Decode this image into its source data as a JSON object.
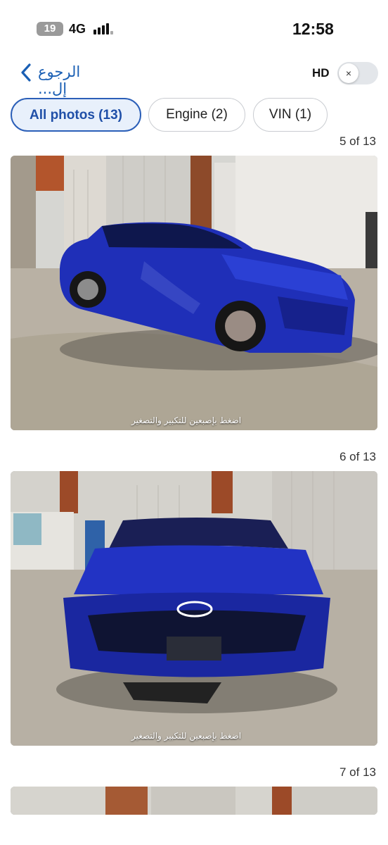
{
  "status_bar": {
    "badge": "19",
    "network": "4G",
    "time": "12:58"
  },
  "nav": {
    "back_label": "الرجوع إل...",
    "hd_label": "HD",
    "hd_toggle_icon": "×",
    "hd_enabled": false
  },
  "tabs": [
    {
      "label": "All photos (13)",
      "active": true
    },
    {
      "label": "Engine (2)",
      "active": false
    },
    {
      "label": "VIN (1)",
      "active": false
    }
  ],
  "photos": [
    {
      "counter": "5 of 13",
      "hint": "اضغط بإصبعين للتكبير والتصغير",
      "subject": "blue sedan side view with damaged doors"
    },
    {
      "counter": "6 of 13",
      "hint": "اضغط بإصبعين للتكبير والتصغير",
      "subject": "blue sedan front view with damaged bumper"
    },
    {
      "counter": "7 of 13",
      "subject": "warehouse interior (partially visible)"
    }
  ],
  "colors": {
    "accent": "#1a5fb4",
    "car_blue": "#1f2fb8",
    "tab_active_bg": "#e8f0fb"
  }
}
